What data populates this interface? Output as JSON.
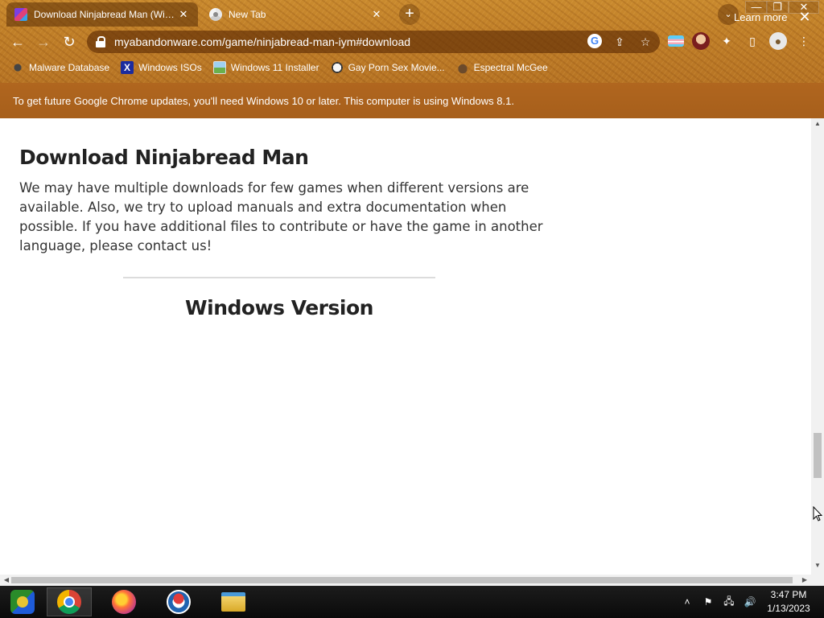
{
  "window": {
    "minimize_glyph": "—",
    "maximize_glyph": "❐",
    "close_glyph": "✕"
  },
  "tabs": [
    {
      "title": "Download Ninjabread Man (Windo",
      "active": true,
      "close_glyph": "✕",
      "favicon": "myabandonware-favicon"
    },
    {
      "title": "New Tab",
      "active": false,
      "close_glyph": "✕",
      "favicon": "chrome-favicon"
    }
  ],
  "toolbar": {
    "new_tab_glyph": "+",
    "tab_search_glyph": "⌄",
    "back_glyph": "←",
    "forward_glyph": "→",
    "reload_glyph": "↻",
    "url": "myabandonware.com/game/ninjabread-man-iym#download",
    "google_glyph": "G",
    "share_glyph": "⇪",
    "bookmark_star_glyph": "☆",
    "extensions_glyph": "✦",
    "side_panel_glyph": "▯",
    "profile_glyph": "●",
    "menu_glyph": "⋮"
  },
  "bookmarks": [
    {
      "label": "Malware Database",
      "icon": "bug-icon"
    },
    {
      "label": "Windows ISOs",
      "icon": "x-icon"
    },
    {
      "label": "Windows 11 Installer",
      "icon": "image-icon"
    },
    {
      "label": "Gay Porn Sex Movie...",
      "icon": "face-icon"
    },
    {
      "label": "Espectral McGee",
      "icon": "dog-icon"
    }
  ],
  "infobar": {
    "message": "To get future Google Chrome updates, you'll need Windows 10 or later. This computer is using Windows 8.1.",
    "learn_more": "Learn more",
    "close_glyph": "✕"
  },
  "page": {
    "heading": "Download Ninjabread Man",
    "body": "We may have multiple downloads for few games when different versions are available. Also, we try to upload manuals and extra documentation when possible. If you have additional files to contribute or have the game in another language, please contact us!",
    "section_heading": "Windows Version"
  },
  "scrollbars": {
    "up_glyph": "▲",
    "down_glyph": "▼",
    "left_glyph": "◀",
    "right_glyph": "▶"
  },
  "taskbar": {
    "apps": [
      "start",
      "chrome",
      "firefox",
      "internet-explorer",
      "file-explorer"
    ],
    "tray_chevron": "˄",
    "flag_glyph": "⚑",
    "network_glyph": "🖧",
    "volume_glyph": "🔊",
    "time": "3:47 PM",
    "date": "1/13/2023"
  },
  "colors": {
    "theme_orange": "#c07f28",
    "infobar": "#a75f1b",
    "taskbar": "#0a0a0a"
  }
}
